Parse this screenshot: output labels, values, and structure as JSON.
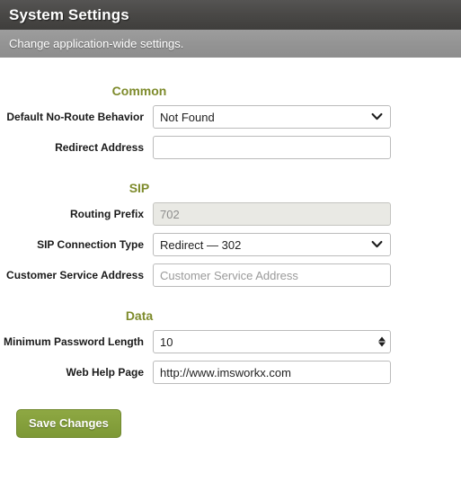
{
  "header": {
    "title": "System Settings",
    "subtitle": "Change application-wide settings.",
    "title_bar_color": "#4a4947",
    "subtitle_bar_color": "#949494"
  },
  "theme": {
    "section_heading_color": "#7e8b2c",
    "button_color": "#85a03c"
  },
  "sections": [
    {
      "heading": "Common",
      "fields": [
        {
          "label": "Default No-Route Behavior",
          "type": "select",
          "value": "Not Found",
          "options": [
            "Not Found"
          ],
          "icon": "chevron-down-icon"
        },
        {
          "label": "Redirect Address",
          "type": "text",
          "value": "",
          "placeholder": ""
        }
      ]
    },
    {
      "heading": "SIP",
      "fields": [
        {
          "label": "Routing Prefix",
          "type": "text",
          "value": "702",
          "placeholder": "",
          "disabled": true
        },
        {
          "label": "SIP Connection Type",
          "type": "select",
          "value": "Redirect — 302",
          "options": [
            "Redirect — 302"
          ],
          "icon": "chevron-down-icon"
        },
        {
          "label": "Customer Service Address",
          "type": "text",
          "value": "",
          "placeholder": "Customer Service Address"
        }
      ]
    },
    {
      "heading": "Data",
      "fields": [
        {
          "label": "Minimum Password Length",
          "type": "number",
          "value": "10",
          "placeholder": ""
        },
        {
          "label": "Web Help Page",
          "type": "text",
          "value": "http://www.imsworkx.com",
          "placeholder": ""
        }
      ]
    }
  ],
  "actions": {
    "save_label": "Save Changes"
  }
}
